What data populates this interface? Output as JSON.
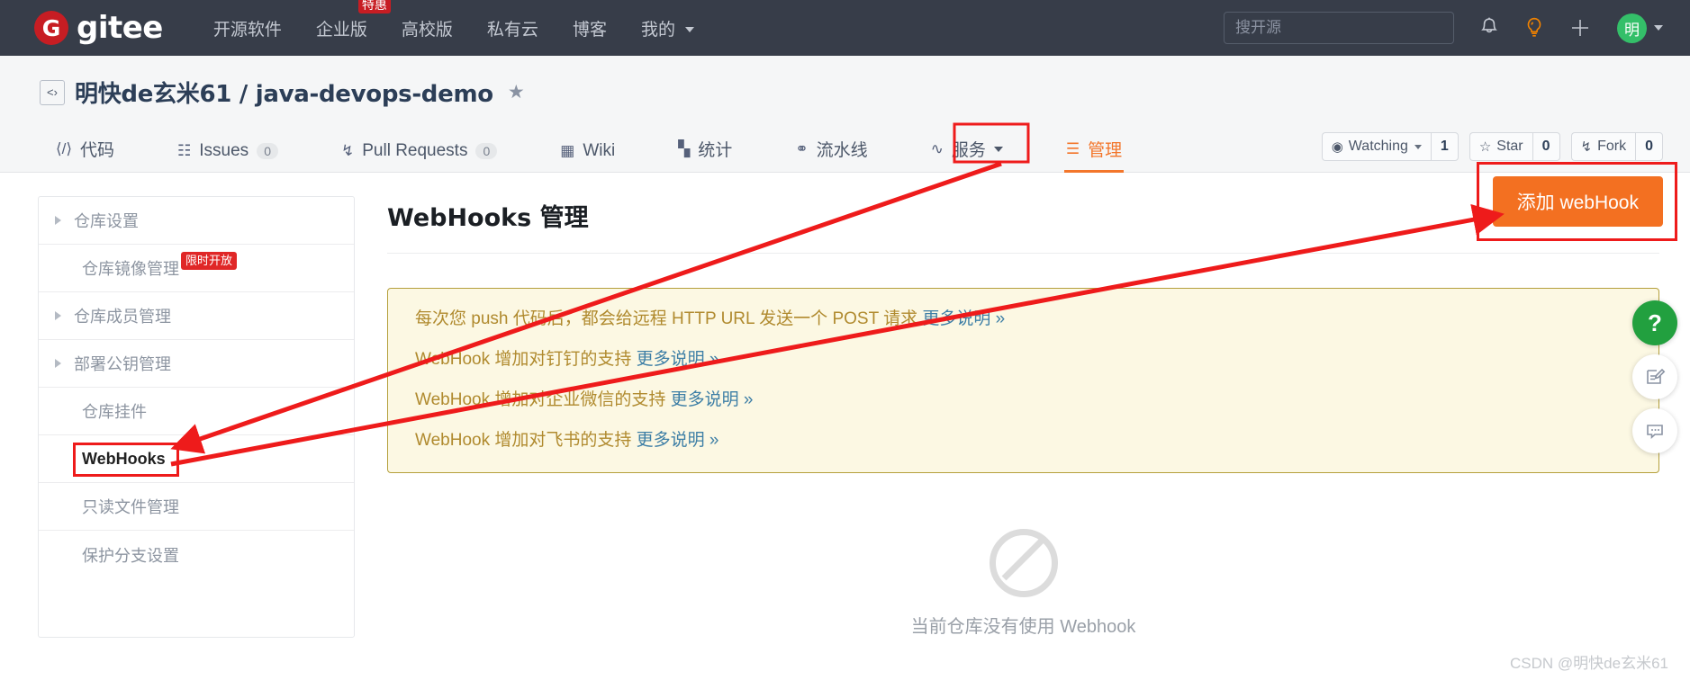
{
  "topnav": {
    "logo_letter": "G",
    "logo_text": "gitee",
    "items": [
      {
        "label": "开源软件",
        "badge": null,
        "caret": false
      },
      {
        "label": "企业版",
        "badge": "特惠",
        "caret": false
      },
      {
        "label": "高校版",
        "badge": null,
        "caret": false
      },
      {
        "label": "私有云",
        "badge": null,
        "caret": false
      },
      {
        "label": "博客",
        "badge": null,
        "caret": false
      },
      {
        "label": "我的",
        "badge": null,
        "caret": true
      }
    ],
    "search_placeholder": "搜开源",
    "icons": [
      "bell-icon",
      "lightbulb-icon",
      "plus-icon"
    ],
    "avatar_text": "明"
  },
  "repo": {
    "owner": "明快de玄米61",
    "separator": " / ",
    "name": "java-devops-demo",
    "actions": [
      {
        "label": "Watching",
        "count": "1",
        "icon": "eye-icon",
        "caret": true
      },
      {
        "label": "Star",
        "count": "0",
        "icon": "star-icon",
        "caret": false
      },
      {
        "label": "Fork",
        "count": "0",
        "icon": "fork-icon",
        "caret": false
      }
    ]
  },
  "tabs": [
    {
      "label": "代码",
      "icon": "code-icon",
      "count": null,
      "caret": false,
      "active": false
    },
    {
      "label": "Issues",
      "icon": "issue-icon",
      "count": "0",
      "caret": false,
      "active": false
    },
    {
      "label": "Pull Requests",
      "icon": "pullrequest-icon",
      "count": "0",
      "caret": false,
      "active": false
    },
    {
      "label": "Wiki",
      "icon": "book-icon",
      "count": null,
      "caret": false,
      "active": false
    },
    {
      "label": "统计",
      "icon": "chart-icon",
      "count": null,
      "caret": false,
      "active": false
    },
    {
      "label": "流水线",
      "icon": "pipeline-icon",
      "count": null,
      "caret": false,
      "active": false
    },
    {
      "label": "服务",
      "icon": "pulse-icon",
      "count": null,
      "caret": true,
      "active": false
    },
    {
      "label": "管理",
      "icon": "settings-list-icon",
      "count": null,
      "caret": false,
      "active": true
    }
  ],
  "sidebar": {
    "items": [
      {
        "label": "仓库设置",
        "arrow": true,
        "badge": null,
        "selected": false
      },
      {
        "label": "仓库镜像管理",
        "arrow": false,
        "badge": "限时开放",
        "selected": false
      },
      {
        "label": "仓库成员管理",
        "arrow": true,
        "badge": null,
        "selected": false
      },
      {
        "label": "部署公钥管理",
        "arrow": true,
        "badge": null,
        "selected": false
      },
      {
        "label": "仓库挂件",
        "arrow": false,
        "badge": null,
        "selected": false
      },
      {
        "label": "WebHooks",
        "arrow": false,
        "badge": null,
        "selected": true
      },
      {
        "label": "只读文件管理",
        "arrow": false,
        "badge": null,
        "selected": false
      },
      {
        "label": "保护分支设置",
        "arrow": false,
        "badge": null,
        "selected": false
      }
    ]
  },
  "main": {
    "title": "WebHooks 管理",
    "add_button": "添加 webHook",
    "notice_lines": [
      {
        "text": "每次您 push 代码后，都会给远程 HTTP URL 发送一个 POST 请求 ",
        "link": "更多说明 »"
      },
      {
        "text": "WebHook 增加对钉钉的支持 ",
        "link": "更多说明 »"
      },
      {
        "text": "WebHook 增加对企业微信的支持 ",
        "link": "更多说明 »"
      },
      {
        "text": "WebHook 增加对飞书的支持 ",
        "link": "更多说明 »"
      }
    ],
    "empty_text": "当前仓库没有使用 Webhook"
  },
  "floaters": [
    {
      "icon": "help-question-icon",
      "style": "green"
    },
    {
      "icon": "feedback-edit-icon",
      "style": "white"
    },
    {
      "icon": "chat-bubble-icon",
      "style": "white"
    }
  ],
  "watermark": "CSDN @明快de玄米61",
  "colors": {
    "brand_red": "#c71d23",
    "topbar_bg": "#373d49",
    "accent_orange": "#f37021",
    "annotation_red": "#ee1b1b",
    "notice_bg": "#fcf8e3",
    "notice_border": "#b5a03c",
    "notice_text": "#b08a2e",
    "avatar_green": "#34bf69"
  }
}
